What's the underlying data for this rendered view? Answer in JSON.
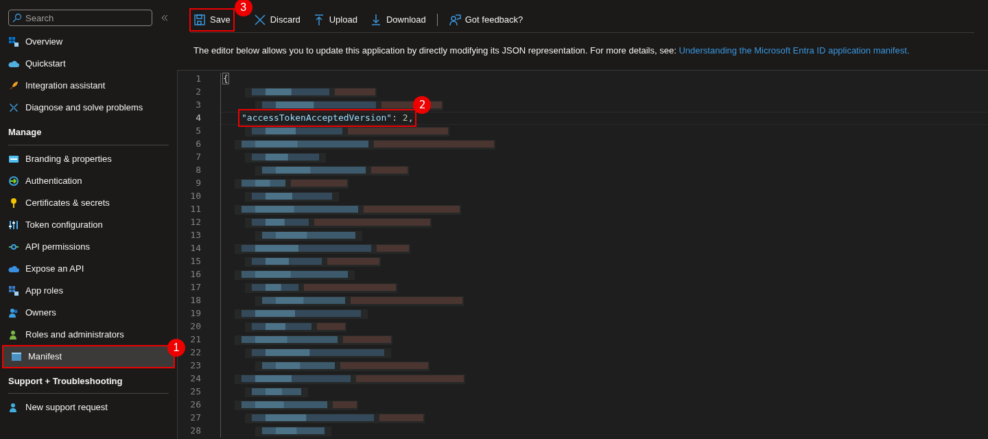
{
  "sidebar": {
    "search": {
      "placeholder": "Search"
    },
    "sections": [
      {
        "items": [
          {
            "label": "Overview",
            "selected": false
          },
          {
            "label": "Quickstart",
            "selected": false
          },
          {
            "label": "Integration assistant",
            "selected": false
          },
          {
            "label": "Diagnose and solve problems",
            "selected": false
          }
        ]
      },
      {
        "heading": "Manage",
        "items": [
          {
            "label": "Branding & properties",
            "selected": false
          },
          {
            "label": "Authentication",
            "selected": false
          },
          {
            "label": "Certificates & secrets",
            "selected": false
          },
          {
            "label": "Token configuration",
            "selected": false
          },
          {
            "label": "API permissions",
            "selected": false
          },
          {
            "label": "Expose an API",
            "selected": false
          },
          {
            "label": "App roles",
            "selected": false
          },
          {
            "label": "Owners",
            "selected": false
          },
          {
            "label": "Roles and administrators",
            "selected": false
          },
          {
            "label": "Manifest",
            "selected": true,
            "callout": "1"
          }
        ]
      },
      {
        "heading": "Support + Troubleshooting",
        "items": [
          {
            "label": "New support request",
            "selected": false
          }
        ]
      }
    ]
  },
  "toolbar": [
    {
      "label": "Save",
      "callout": "3"
    },
    {
      "label": "Discard"
    },
    {
      "label": "Upload"
    },
    {
      "label": "Download"
    },
    {
      "label": "Got feedback?"
    }
  ],
  "description": {
    "text": "The editor below allows you to update this application by directly modifying its JSON representation. For more details, see:",
    "link": "Understanding the Microsoft Entra ID application manifest."
  },
  "editor": {
    "lines": [
      {
        "number": "1",
        "kind": "code",
        "current": false,
        "tokens": [
          {
            "kind": "bracket",
            "text": "{"
          }
        ]
      },
      {
        "number": "2",
        "kind": "redacted",
        "current": false
      },
      {
        "number": "3",
        "kind": "redacted",
        "current": false
      },
      {
        "number": "4",
        "kind": "code",
        "current": true,
        "callout": "2",
        "tokens": [
          {
            "kind": "key",
            "text": "\"accessTokenAcceptedVersion\""
          },
          {
            "kind": "punct",
            "text": ": "
          },
          {
            "kind": "number",
            "text": "2"
          },
          {
            "kind": "punct",
            "text": ","
          }
        ]
      },
      {
        "number": "5",
        "kind": "redacted",
        "current": false
      },
      {
        "number": "6",
        "kind": "redacted",
        "current": false
      },
      {
        "number": "7",
        "kind": "redacted",
        "current": false
      },
      {
        "number": "8",
        "kind": "redacted",
        "current": false
      },
      {
        "number": "9",
        "kind": "redacted",
        "current": false
      },
      {
        "number": "10",
        "kind": "redacted",
        "current": false
      },
      {
        "number": "11",
        "kind": "redacted",
        "current": false
      },
      {
        "number": "12",
        "kind": "redacted",
        "current": false
      },
      {
        "number": "13",
        "kind": "redacted",
        "current": false
      },
      {
        "number": "14",
        "kind": "redacted",
        "current": false
      },
      {
        "number": "15",
        "kind": "redacted",
        "current": false
      },
      {
        "number": "16",
        "kind": "redacted",
        "current": false
      },
      {
        "number": "17",
        "kind": "redacted",
        "current": false
      },
      {
        "number": "18",
        "kind": "redacted",
        "current": false
      },
      {
        "number": "19",
        "kind": "redacted",
        "current": false
      },
      {
        "number": "20",
        "kind": "redacted",
        "current": false
      },
      {
        "number": "21",
        "kind": "redacted",
        "current": false
      },
      {
        "number": "22",
        "kind": "redacted",
        "current": false
      },
      {
        "number": "23",
        "kind": "redacted",
        "current": false
      },
      {
        "number": "24",
        "kind": "redacted",
        "current": false
      },
      {
        "number": "25",
        "kind": "redacted",
        "current": false
      },
      {
        "number": "26",
        "kind": "redacted",
        "current": false
      },
      {
        "number": "27",
        "kind": "redacted",
        "current": false
      },
      {
        "number": "28",
        "kind": "redacted",
        "current": false
      }
    ]
  }
}
